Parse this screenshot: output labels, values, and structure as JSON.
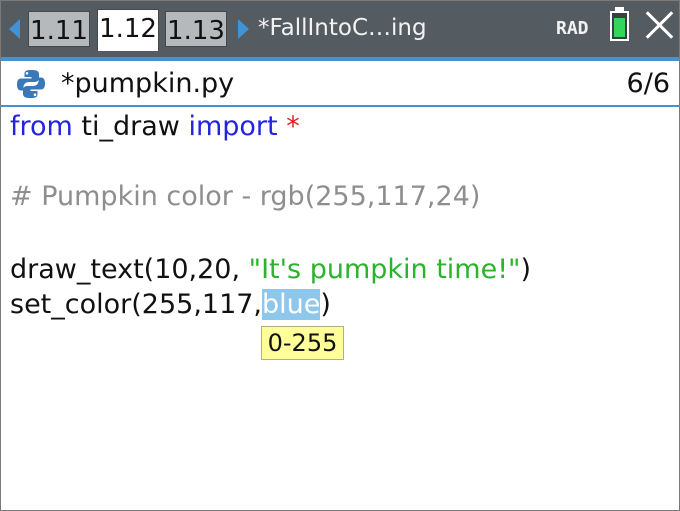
{
  "tabs": [
    "1.11",
    "1.12",
    "1.13"
  ],
  "active_tab": "1.12",
  "document_title": "*FallIntoC…ing",
  "status": {
    "angle_mode": "RAD"
  },
  "battery_level": 0.85,
  "colors": {
    "title_bar": "#545b61",
    "accent": "#3f93d6",
    "keyword": "#2424e0",
    "operator": "#e02020",
    "comment": "#8e8e8e",
    "string": "#2bb32b",
    "selection": "#8ec7ec",
    "tooltip": "#ffff99",
    "battery": "#35d45a"
  },
  "icons": {
    "nav_left": "left-arrow-icon",
    "nav_right": "right-arrow-icon",
    "battery": "battery-icon",
    "close": "close-icon",
    "python": "python-icon"
  },
  "editor": {
    "file_name": "*pumpkin.py",
    "line_position": "6/6",
    "lines": {
      "l1": {
        "kw_from": "from",
        "module": " ti_draw ",
        "kw_import": "import",
        "star": " *"
      },
      "l3": {
        "comment": "# Pumpkin color - rgb(255,117,24)"
      },
      "l5": {
        "call": "draw_text(10,20, ",
        "string": "\"It's pumpkin time!\"",
        "close": ")"
      },
      "l6": {
        "call": "set_color(255,117,",
        "selected": "blue",
        "close": ")"
      }
    },
    "tooltip": "0-255"
  }
}
